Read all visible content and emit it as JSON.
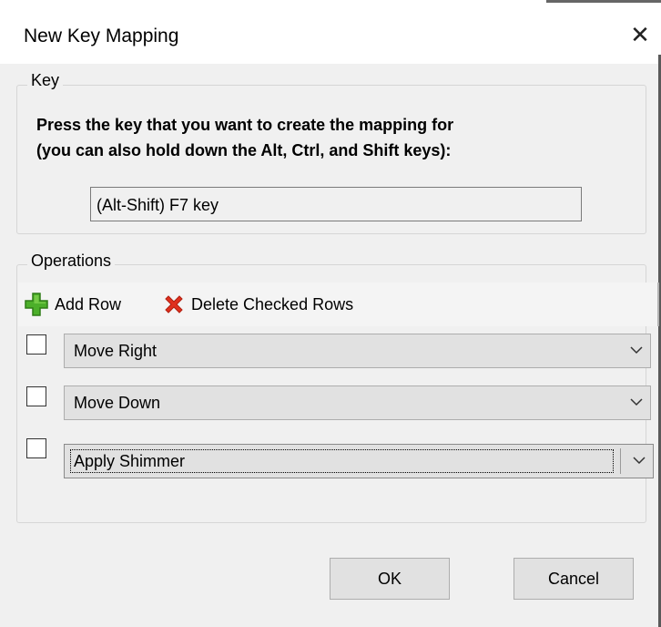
{
  "window": {
    "title": "New Key Mapping",
    "close_label": "✕"
  },
  "key_group": {
    "legend": "Key",
    "instruction_line1": "Press the key that you want to create the mapping for",
    "instruction_line2": "(you can also hold down the Alt, Ctrl, and Shift keys):",
    "key_value": "(Alt-Shift) F7 key"
  },
  "operations_group": {
    "legend": "Operations",
    "toolbar": {
      "add_row_label": "Add Row",
      "add_row_icon": "green-plus-icon",
      "delete_label": "Delete Checked Rows",
      "delete_icon": "red-x-icon"
    },
    "rows": [
      {
        "checked": false,
        "operation": "Move Right"
      },
      {
        "checked": false,
        "operation": "Move Down"
      },
      {
        "checked": false,
        "operation": "Apply Shimmer",
        "focused": true
      }
    ]
  },
  "buttons": {
    "ok_label": "OK",
    "cancel_label": "Cancel"
  },
  "colors": {
    "dialog_bg": "#f0f0f0",
    "button_bg": "#e1e1e1",
    "add_icon": "#4caf2a",
    "delete_icon": "#e0301e"
  }
}
